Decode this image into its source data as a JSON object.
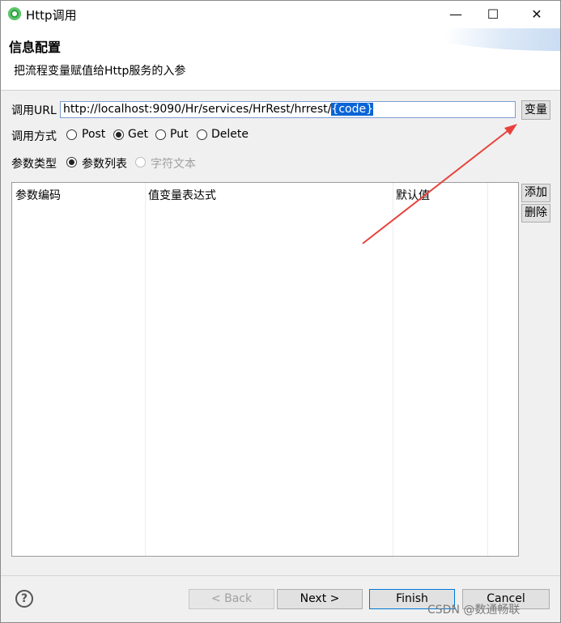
{
  "window": {
    "title": "Http调用",
    "minimize_glyph": "—",
    "maximize_glyph": "☐",
    "close_glyph": "✕"
  },
  "header": {
    "title": "信息配置",
    "description": "把流程变量赋值给Http服务的入参"
  },
  "url": {
    "label": "调用URL",
    "value_prefix": "http://localhost:9090/Hr/services/HrRest/hrrest/",
    "value_selected": "{code}",
    "variable_button": "变量"
  },
  "method": {
    "label": "调用方式",
    "options": [
      "Post",
      "Get",
      "Put",
      "Delete"
    ],
    "selected": "Get"
  },
  "param_type": {
    "label": "参数类型",
    "options": [
      "参数列表",
      "字符文本"
    ],
    "selected": "参数列表",
    "disabled_option": "字符文本"
  },
  "table": {
    "columns": [
      "参数编码",
      "值变量表达式",
      "默认值"
    ],
    "rows": []
  },
  "side_buttons": {
    "add": "添加",
    "delete": "删除"
  },
  "footer": {
    "help_icon": "?",
    "back": "< Back",
    "next": "Next >",
    "finish": "Finish",
    "cancel": "Cancel"
  },
  "watermark": "CSDN @数通畅联",
  "colors": {
    "selection": "#0a64d6",
    "arrow": "#e8413b"
  }
}
